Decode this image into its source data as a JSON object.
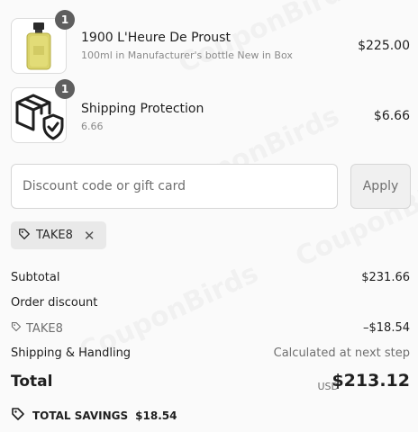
{
  "items": [
    {
      "title": "1900 L'Heure De Proust",
      "subtitle": "100ml in Manufacturer's bottle New in Box",
      "price": "$225.00",
      "quantity": "1",
      "image_icon": "perfume-bottle-icon"
    },
    {
      "title": "Shipping Protection",
      "subtitle": "6.66",
      "price": "$6.66",
      "quantity": "1",
      "image_icon": "package-shield-icon"
    }
  ],
  "discount": {
    "placeholder": "Discount code or gift card",
    "value": "",
    "apply_label": "Apply",
    "applied_code": "TAKE8"
  },
  "summary": {
    "subtotal_label": "Subtotal",
    "subtotal_value": "$231.66",
    "order_discount_label": "Order discount",
    "discount_code": "TAKE8",
    "discount_value": "–$18.54",
    "shipping_label": "Shipping & Handling",
    "shipping_value": "Calculated at next step",
    "total_label": "Total",
    "currency": "USD",
    "total_value": "$213.12",
    "savings_label": "TOTAL SAVINGS",
    "savings_value": "$18.54"
  },
  "watermark": "CouponBirds",
  "colors": {
    "background": "#fafafa",
    "badge": "#5e5e5e",
    "chip": "#e9e9e9",
    "text": "#1f1f1f",
    "muted": "#6f6f6f"
  }
}
